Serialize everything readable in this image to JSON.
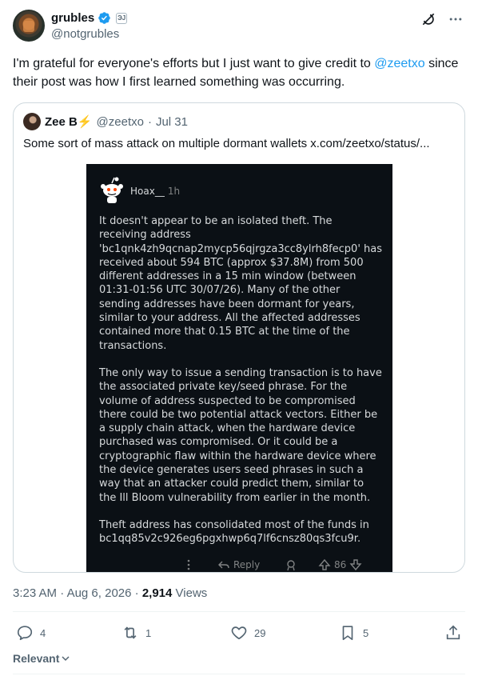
{
  "author": {
    "display_name": "grubles",
    "handle": "@notgrubles",
    "affiliate_badge": "ЭЈ"
  },
  "tweet": {
    "text_before": "I'm grateful for everyone's efforts but I just want to give credit to ",
    "mention": "@zeetxo",
    "text_after": " since their post was how I first learned something was occurring."
  },
  "quote": {
    "display_name": "Zee B⚡",
    "handle": "@zeetxo",
    "separator": "·",
    "date": "Jul 31",
    "text": "Some sort of mass attack on multiple dormant wallets  x.com/zeetxo/status/..."
  },
  "reddit": {
    "username": "Hoax__",
    "time": "1h",
    "paragraphs": [
      "It doesn't appear to be an isolated theft. The receiving address 'bc1qnk4zh9qcnap2mycp56qjrgza3cc8ylrh8fecp0' has received about 594 BTC (approx $37.8M) from 500 different addresses in a 15 min window (between 01:31-01:56 UTC 30/07/26). Many of the other sending addresses have been dormant for years, similar to your address. All the affected addresses contained more that 0.15 BTC at the time of the transactions.",
      "The only way to issue a sending transaction is to have the associated private key/seed phrase. For the volume of address suspected to be compromised there could be two potential attack vectors. Either be a supply chain attack, when the hardware device purchased was compromised. Or it could be a cryptographic flaw within the hardware device where the device generates users seed phrases in such a way that an attacker could predict them, similar to the Ill Bloom vulnerability from earlier in the month.",
      "Theft address has consolidated most of the funds in bc1qq85v2c926eg6pgxhwp6q7lf6cnsz80qs3fcu9r."
    ],
    "reply_label": "Reply",
    "vote_count": "86"
  },
  "meta": {
    "time": "3:23 AM",
    "separator": "·",
    "date": "Aug 6, 2026",
    "views_count": "2,914",
    "views_label": "Views"
  },
  "actions": {
    "replies": "4",
    "reposts": "1",
    "likes": "29",
    "bookmarks": "5"
  },
  "sort": {
    "label": "Relevant"
  },
  "colors": {
    "accent": "#1d9bf0",
    "text": "#0f1419",
    "secondary": "#536471",
    "reddit_bg": "#0b1015"
  }
}
